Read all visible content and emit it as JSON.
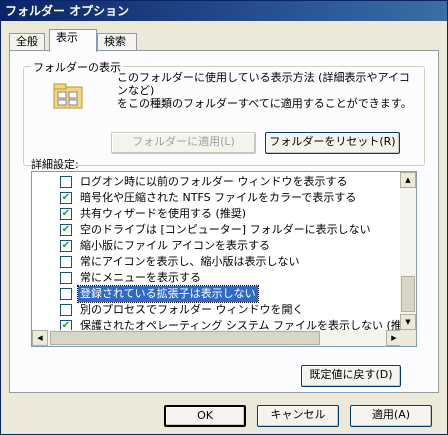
{
  "window": {
    "title": "フォルダー オプション"
  },
  "tabs": [
    {
      "label": "全般"
    },
    {
      "label": "表示"
    },
    {
      "label": "検索"
    }
  ],
  "folder_view": {
    "group_title": "フォルダーの表示",
    "description_line1": "このフォルダーに使用している表示方法 (詳細表示やアイコンなど)",
    "description_line2": "をこの種類のフォルダーすべてに適用することができます。",
    "apply_button": "フォルダーに適用(L)",
    "reset_button": "フォルダーをリセット(R)"
  },
  "advanced": {
    "label": "詳細設定:",
    "items": [
      {
        "label": "ログオン時に以前のフォルダー ウィンドウを表示する",
        "checked": false
      },
      {
        "label": "暗号化や圧縮された NTFS ファイルをカラーで表示する",
        "checked": true
      },
      {
        "label": "共有ウィザードを使用する (推奨)",
        "checked": true
      },
      {
        "label": "空のドライブは [コンピューター] フォルダーに表示しない",
        "checked": true
      },
      {
        "label": "縮小版にファイル アイコンを表示する",
        "checked": true
      },
      {
        "label": "常にアイコンを表示し、縮小版は表示しない",
        "checked": false
      },
      {
        "label": "常にメニューを表示する",
        "checked": false
      },
      {
        "label": "登録されている拡張子は表示しない",
        "checked": false,
        "selected": true
      },
      {
        "label": "別のプロセスでフォルダー ウィンドウを開く",
        "checked": false
      },
      {
        "label": "保護されたオペレーティング システム ファイルを表示しない (推奨)",
        "checked": true
      }
    ],
    "restore_button": "既定値に戻す(D)"
  },
  "footer": {
    "ok": "OK",
    "cancel": "キャンセル",
    "apply": "適用(A)"
  },
  "icons": {
    "check_glyph": "✔",
    "scroll_up": "▲",
    "scroll_down": "▼",
    "scroll_left": "◀",
    "scroll_right": "▶"
  }
}
